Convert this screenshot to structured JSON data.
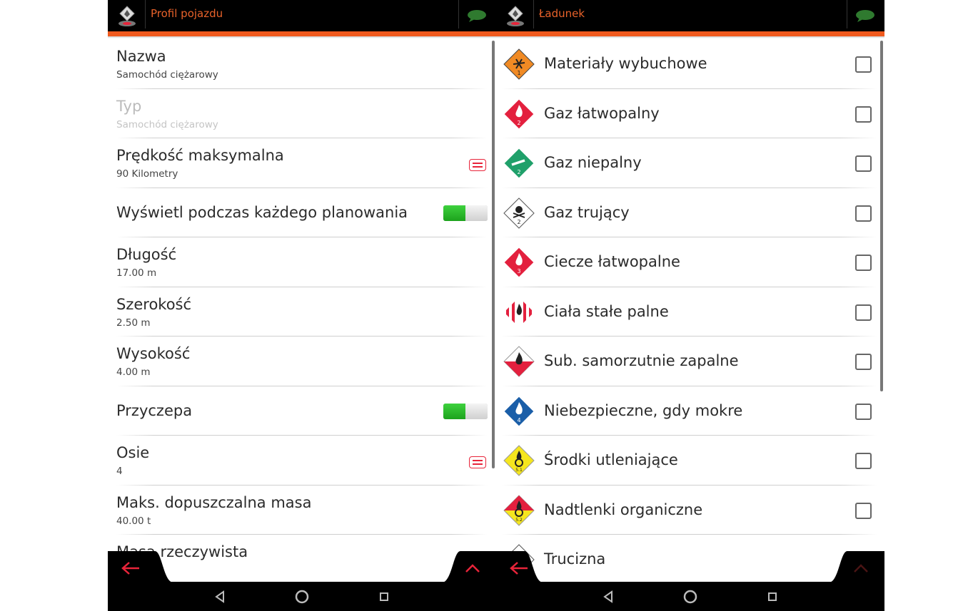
{
  "left": {
    "title": "Profil pojazdu",
    "items": [
      {
        "label": "Nazwa",
        "value": "Samochód ciężarowy"
      },
      {
        "label": "Typ",
        "value": "Samochód ciężarowy"
      },
      {
        "label": "Prędkość maksymalna",
        "value": "90 Kilometry"
      },
      {
        "label": "Wyświetl podczas każdego planowania"
      },
      {
        "label": "Długość",
        "value": "17.00 m"
      },
      {
        "label": "Szerokość",
        "value": "2.50 m"
      },
      {
        "label": "Wysokość",
        "value": "4.00 m"
      },
      {
        "label": "Przyczepa"
      },
      {
        "label": "Osie",
        "value": "4"
      },
      {
        "label": "Maks. dopuszczalna masa",
        "value": "40.00 t"
      },
      {
        "label": "Masa rzeczywista"
      }
    ],
    "toggles": {
      "display_each_planning": true,
      "trailer": true
    }
  },
  "right": {
    "title": "Ładunek",
    "items": [
      {
        "label": "Materiały wybuchowe",
        "checked": false
      },
      {
        "label": "Gaz łatwopalny",
        "checked": false
      },
      {
        "label": "Gaz niepalny",
        "checked": false
      },
      {
        "label": "Gaz trujący",
        "checked": false
      },
      {
        "label": "Ciecze łatwopalne",
        "checked": false
      },
      {
        "label": "Ciała stałe palne",
        "checked": false
      },
      {
        "label": "Sub. samorzutnie zapalne",
        "checked": false
      },
      {
        "label": "Niebezpieczne, gdy mokre",
        "checked": false
      },
      {
        "label": "Środki utleniające",
        "checked": false
      },
      {
        "label": "Nadtlenki organiczne",
        "checked": false
      },
      {
        "label": "Trucizna",
        "checked": false
      }
    ],
    "hazard_numbers": [
      "1",
      "2",
      "2",
      "2",
      "3",
      "",
      "",
      "4",
      "5.1",
      "5.2",
      ""
    ]
  },
  "colors": {
    "accent": "#f05a1e",
    "title": "#e8622a",
    "icon_red": "#e8243a",
    "toggle_on": "#2dbd2d"
  },
  "icons": {
    "back": "arrow-left-icon",
    "up": "chevron-up-icon",
    "chat": "speech-bubble-icon"
  }
}
